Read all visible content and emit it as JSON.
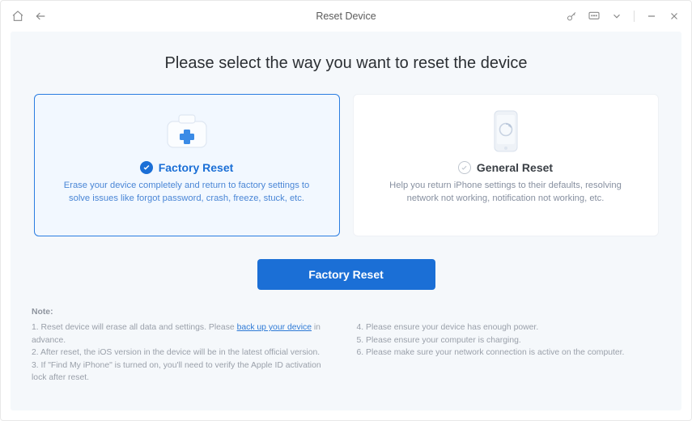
{
  "window": {
    "title": "Reset Device"
  },
  "heading": "Please select the way you want to reset the device",
  "cards": {
    "factory": {
      "title": "Factory Reset",
      "desc": "Erase your device completely and return to factory settings to solve issues like forgot password, crash, freeze, stuck, etc."
    },
    "general": {
      "title": "General Reset",
      "desc": "Help you return iPhone settings to their defaults, resolving network not working, notification not working, etc."
    }
  },
  "primary_button": "Factory Reset",
  "notes": {
    "title": "Note:",
    "n1a": "1. Reset device will erase all data and settings. Please ",
    "n1link": "back up your device",
    "n1b": " in advance.",
    "n2": "2. After reset, the iOS version in the device will be in the latest official version.",
    "n3": "3. If \"Find My iPhone\" is turned on, you'll need to verify the Apple ID activation lock after reset.",
    "n4": "4. Please ensure your device has enough power.",
    "n5": "5. Please ensure your computer is charging.",
    "n6": "6. Please make sure your network connection is active on the computer."
  }
}
